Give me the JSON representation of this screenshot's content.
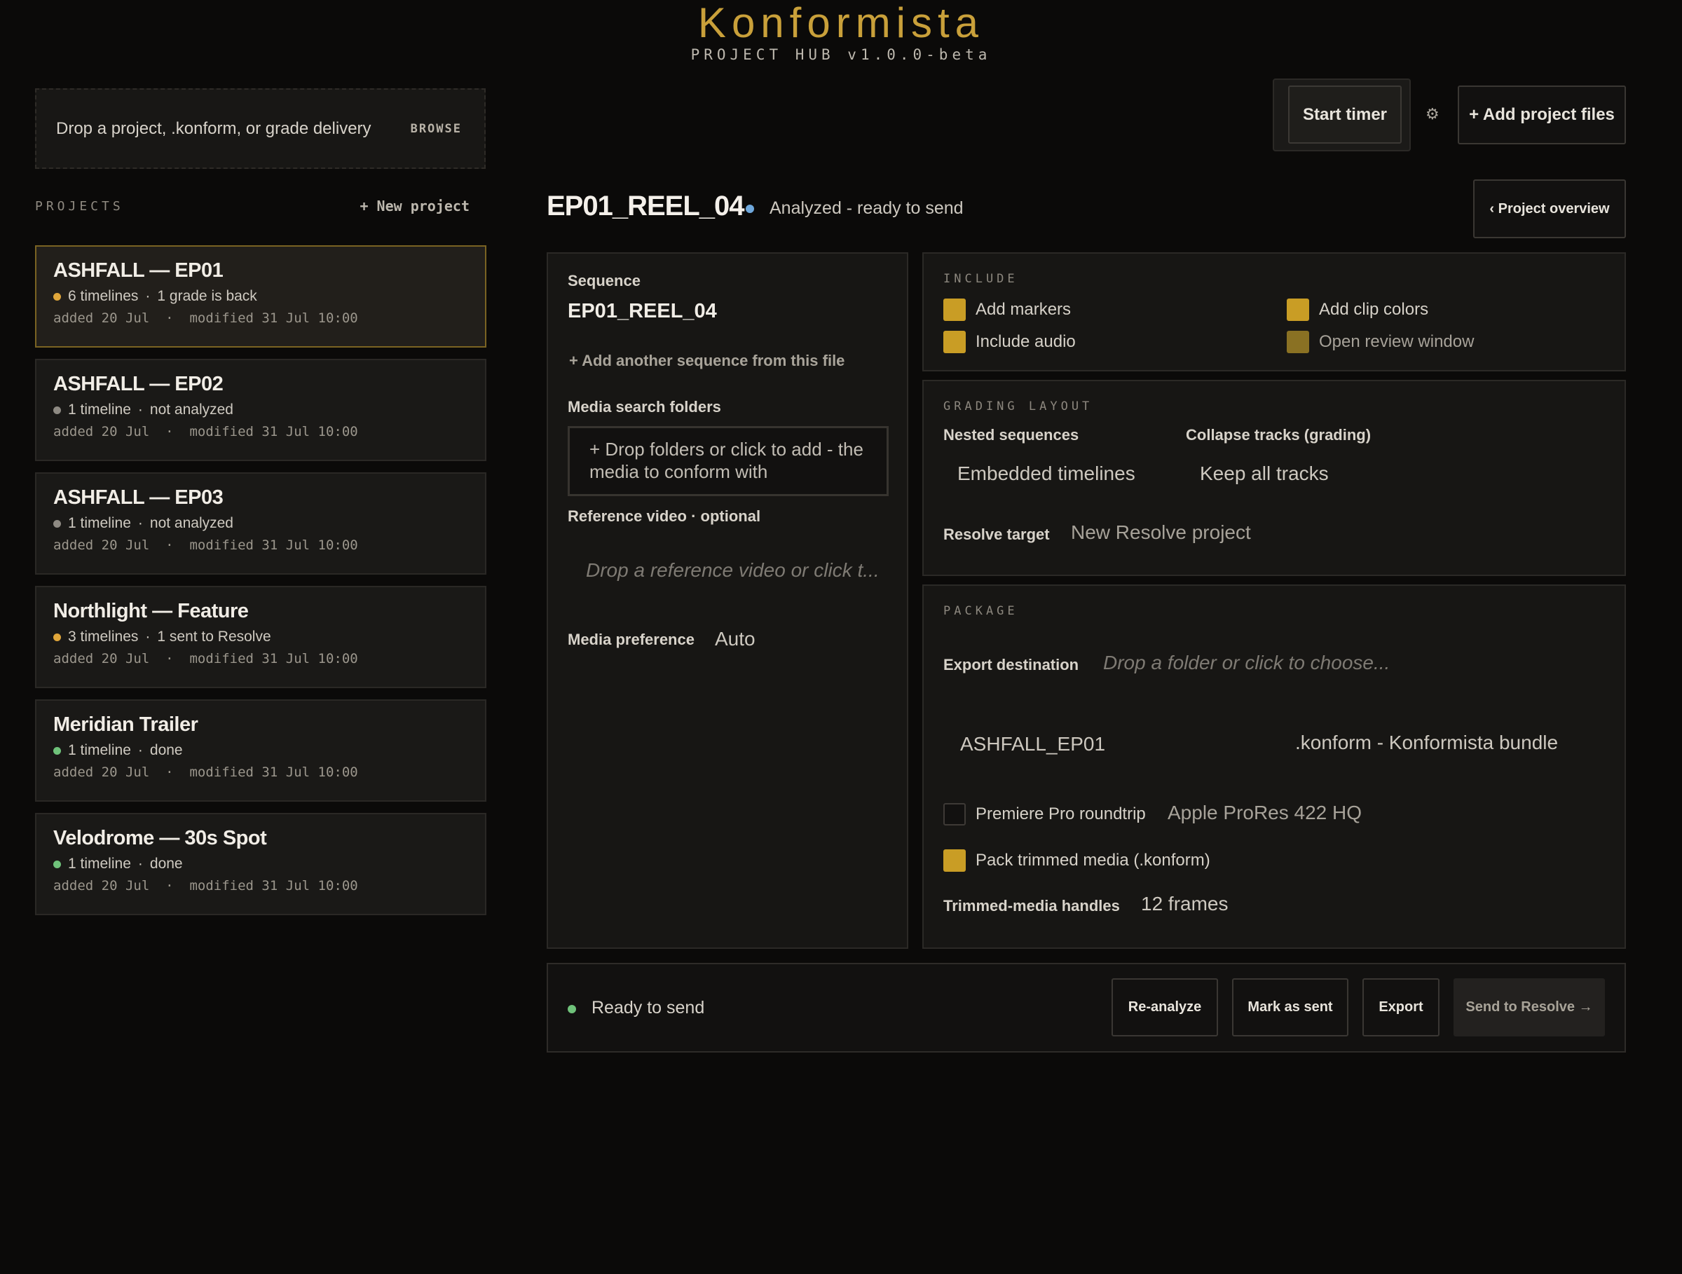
{
  "brand": {
    "title": "Konformista",
    "subtitle": "PROJECT HUB v1.0.0-beta"
  },
  "dropzone": {
    "text": "Drop a project, .konform, or grade delivery",
    "browse": "BROWSE"
  },
  "projects": {
    "label": "PROJECTS",
    "new_label": "+ New project",
    "items": [
      {
        "name": "ASHFALL — EP01",
        "status_color": "#e0a63a",
        "timelines": "6 timelines",
        "state": "1 grade is back",
        "added": "added 20 Jul",
        "modified": "modified 31 Jul 10:00"
      },
      {
        "name": "ASHFALL — EP02",
        "status_color": "#8e8a83",
        "timelines": "1 timeline",
        "state": "not analyzed",
        "added": "added 20 Jul",
        "modified": "modified 31 Jul 10:00"
      },
      {
        "name": "ASHFALL — EP03",
        "status_color": "#8e8a83",
        "timelines": "1 timeline",
        "state": "not analyzed",
        "added": "added 20 Jul",
        "modified": "modified 31 Jul 10:00"
      },
      {
        "name": "Northlight — Feature",
        "status_color": "#e0a63a",
        "timelines": "3 timelines",
        "state": "1 sent to Resolve",
        "added": "added 20 Jul",
        "modified": "modified 31 Jul 10:00"
      },
      {
        "name": "Meridian Trailer",
        "status_color": "#6fc27a",
        "timelines": "1 timeline",
        "state": "done",
        "added": "added 20 Jul",
        "modified": "modified 31 Jul 10:00"
      },
      {
        "name": "Velodrome — 30s Spot",
        "status_color": "#6fc27a",
        "timelines": "1 timeline",
        "state": "done",
        "added": "added 20 Jul",
        "modified": "modified 31 Jul 10:00"
      }
    ]
  },
  "toolbar": {
    "start_timer": "Start timer",
    "gear": "⚙",
    "add_files": "+ Add project files"
  },
  "project": {
    "title": "EP01_REEL_04",
    "status": "Analyzed - ready to send",
    "overview": "‹ Project overview"
  },
  "sequence_panel": {
    "sequence_label": "Sequence",
    "sequence_value": "EP01_REEL_04",
    "add_sequence": "+ Add another sequence from this file",
    "media_folders_label": "Media search folders",
    "media_folders_placeholder": "+ Drop folders or click to add - the media to conform with",
    "ref_video_label": "Reference video · optional",
    "ref_video_placeholder": "Drop a reference video or click t...",
    "media_pref_label": "Media preference",
    "media_pref_value": "Auto"
  },
  "include": {
    "label": "INCLUDE",
    "add_markers": "Add markers",
    "include_audio": "Include audio",
    "add_clip_colors": "Add clip colors",
    "open_review": "Open review window"
  },
  "grading": {
    "label": "GRADING LAYOUT",
    "nested_label": "Nested sequences",
    "nested_value": "Embedded timelines",
    "collapse_label": "Collapse tracks (grading)",
    "collapse_value": "Keep all tracks",
    "resolve_label": "Resolve target",
    "resolve_value": "New Resolve project"
  },
  "package": {
    "label": "PACKAGE",
    "export_label": "Export destination",
    "export_placeholder": "Drop a folder or click to choose...",
    "name_value": "ASHFALL_EP01",
    "format_value": ".konform - Konformista bundle",
    "premiere": "Premiere Pro roundtrip",
    "codec": "Apple ProRes 422 HQ",
    "pack_trimmed": "Pack trimmed media (.konform)",
    "handles_label": "Trimmed-media handles",
    "handles_value": "12 frames"
  },
  "footer": {
    "status": "Ready to send",
    "reanalyze": "Re-analyze",
    "mark_sent": "Mark as sent",
    "export": "Export",
    "send": "Send to Resolve →"
  }
}
